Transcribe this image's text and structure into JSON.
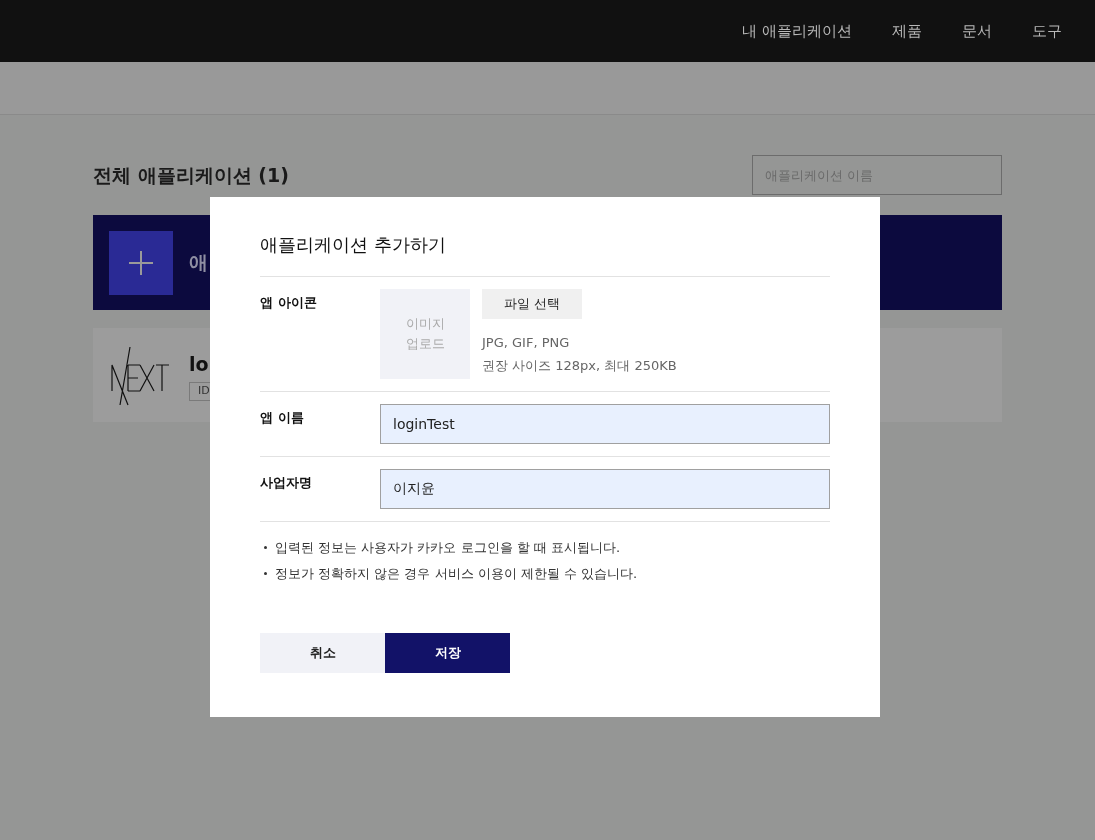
{
  "header": {
    "nav": [
      "내 애플리케이션",
      "제품",
      "문서",
      "도구"
    ]
  },
  "page": {
    "title": "전체 애플리케이션 (1)",
    "search": {
      "placeholder": "애플리케이션 이름"
    },
    "add_banner": {
      "label": "애"
    },
    "app_card": {
      "name": "lo",
      "badge": "ID"
    }
  },
  "dialog": {
    "title": "애플리케이션 추가하기",
    "icon_row": {
      "label": "앱 아이콘",
      "upload": "이미지\n업로드",
      "file_button": "파일 선택",
      "hints": [
        "JPG, GIF, PNG",
        "권장 사이즈 128px, 최대 250KB"
      ]
    },
    "fields": [
      {
        "label": "앱 이름",
        "value": "loginTest"
      },
      {
        "label": "사업자명",
        "value": "이지윤"
      }
    ],
    "notes": [
      "입력된 정보는 사용자가 카카오 로그인을 할 때 표시됩니다.",
      "정보가 정확하지 않은 경우 서비스 이용이 제한될 수 있습니다."
    ],
    "buttons": [
      {
        "kind": "secondary",
        "label": "취소"
      },
      {
        "kind": "primary",
        "label": "저장"
      }
    ]
  }
}
